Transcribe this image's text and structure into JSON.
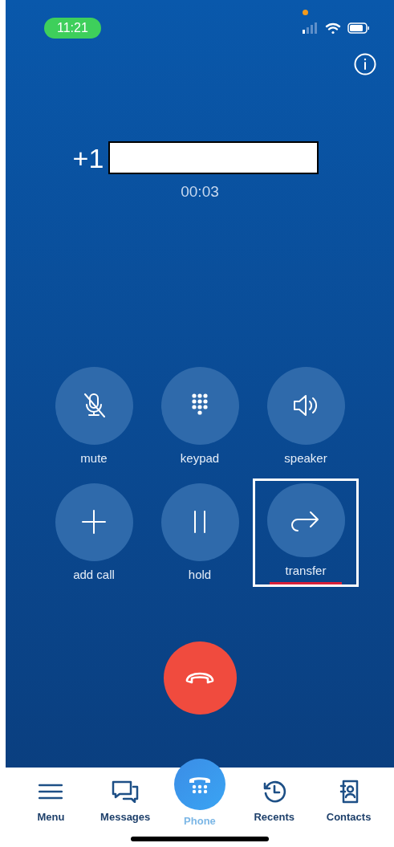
{
  "status_bar": {
    "time": "11:21"
  },
  "call": {
    "number_prefix": "+1",
    "number_redacted": true,
    "duration": "00:03"
  },
  "controls": [
    {
      "kind": "mute",
      "label": "mute",
      "highlighted": false
    },
    {
      "kind": "keypad",
      "label": "keypad",
      "highlighted": false
    },
    {
      "kind": "speaker",
      "label": "speaker",
      "highlighted": false
    },
    {
      "kind": "add",
      "label": "add call",
      "highlighted": false
    },
    {
      "kind": "hold",
      "label": "hold",
      "highlighted": false
    },
    {
      "kind": "transfer",
      "label": "transfer",
      "highlighted": true
    }
  ],
  "nav": [
    {
      "kind": "menu",
      "label": "Menu",
      "selected": false
    },
    {
      "kind": "messages",
      "label": "Messages",
      "selected": false
    },
    {
      "kind": "phone",
      "label": "Phone",
      "selected": true
    },
    {
      "kind": "recents",
      "label": "Recents",
      "selected": false
    },
    {
      "kind": "contacts",
      "label": "Contacts",
      "selected": false
    }
  ]
}
